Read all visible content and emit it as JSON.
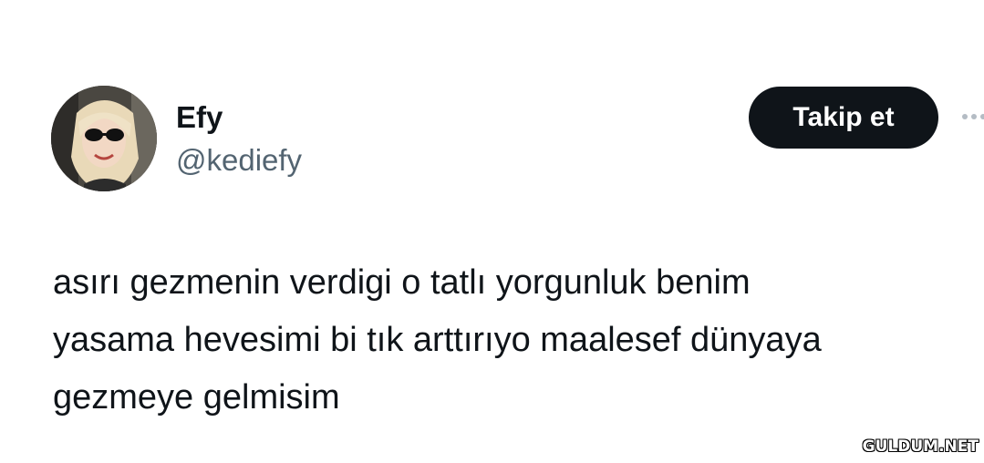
{
  "tweet": {
    "author": {
      "display_name": "Efy",
      "handle": "@kediefy",
      "avatar_icon": "profile-photo"
    },
    "follow_button_label": "Takip et",
    "more_icon": "more-dots-icon",
    "text": "asırı gezmenin verdigi o tatlı yorgunluk benim\nyasama hevesimi bi tık arttırıyo maalesef dünyaya\ngezmeye gelmisim"
  },
  "watermark": {
    "text": "GULDUM.NET"
  },
  "colors": {
    "primary_text": "#0f1419",
    "secondary_text": "#536471",
    "button_bg": "#0f1419",
    "button_text": "#ffffff",
    "background": "#ffffff"
  }
}
